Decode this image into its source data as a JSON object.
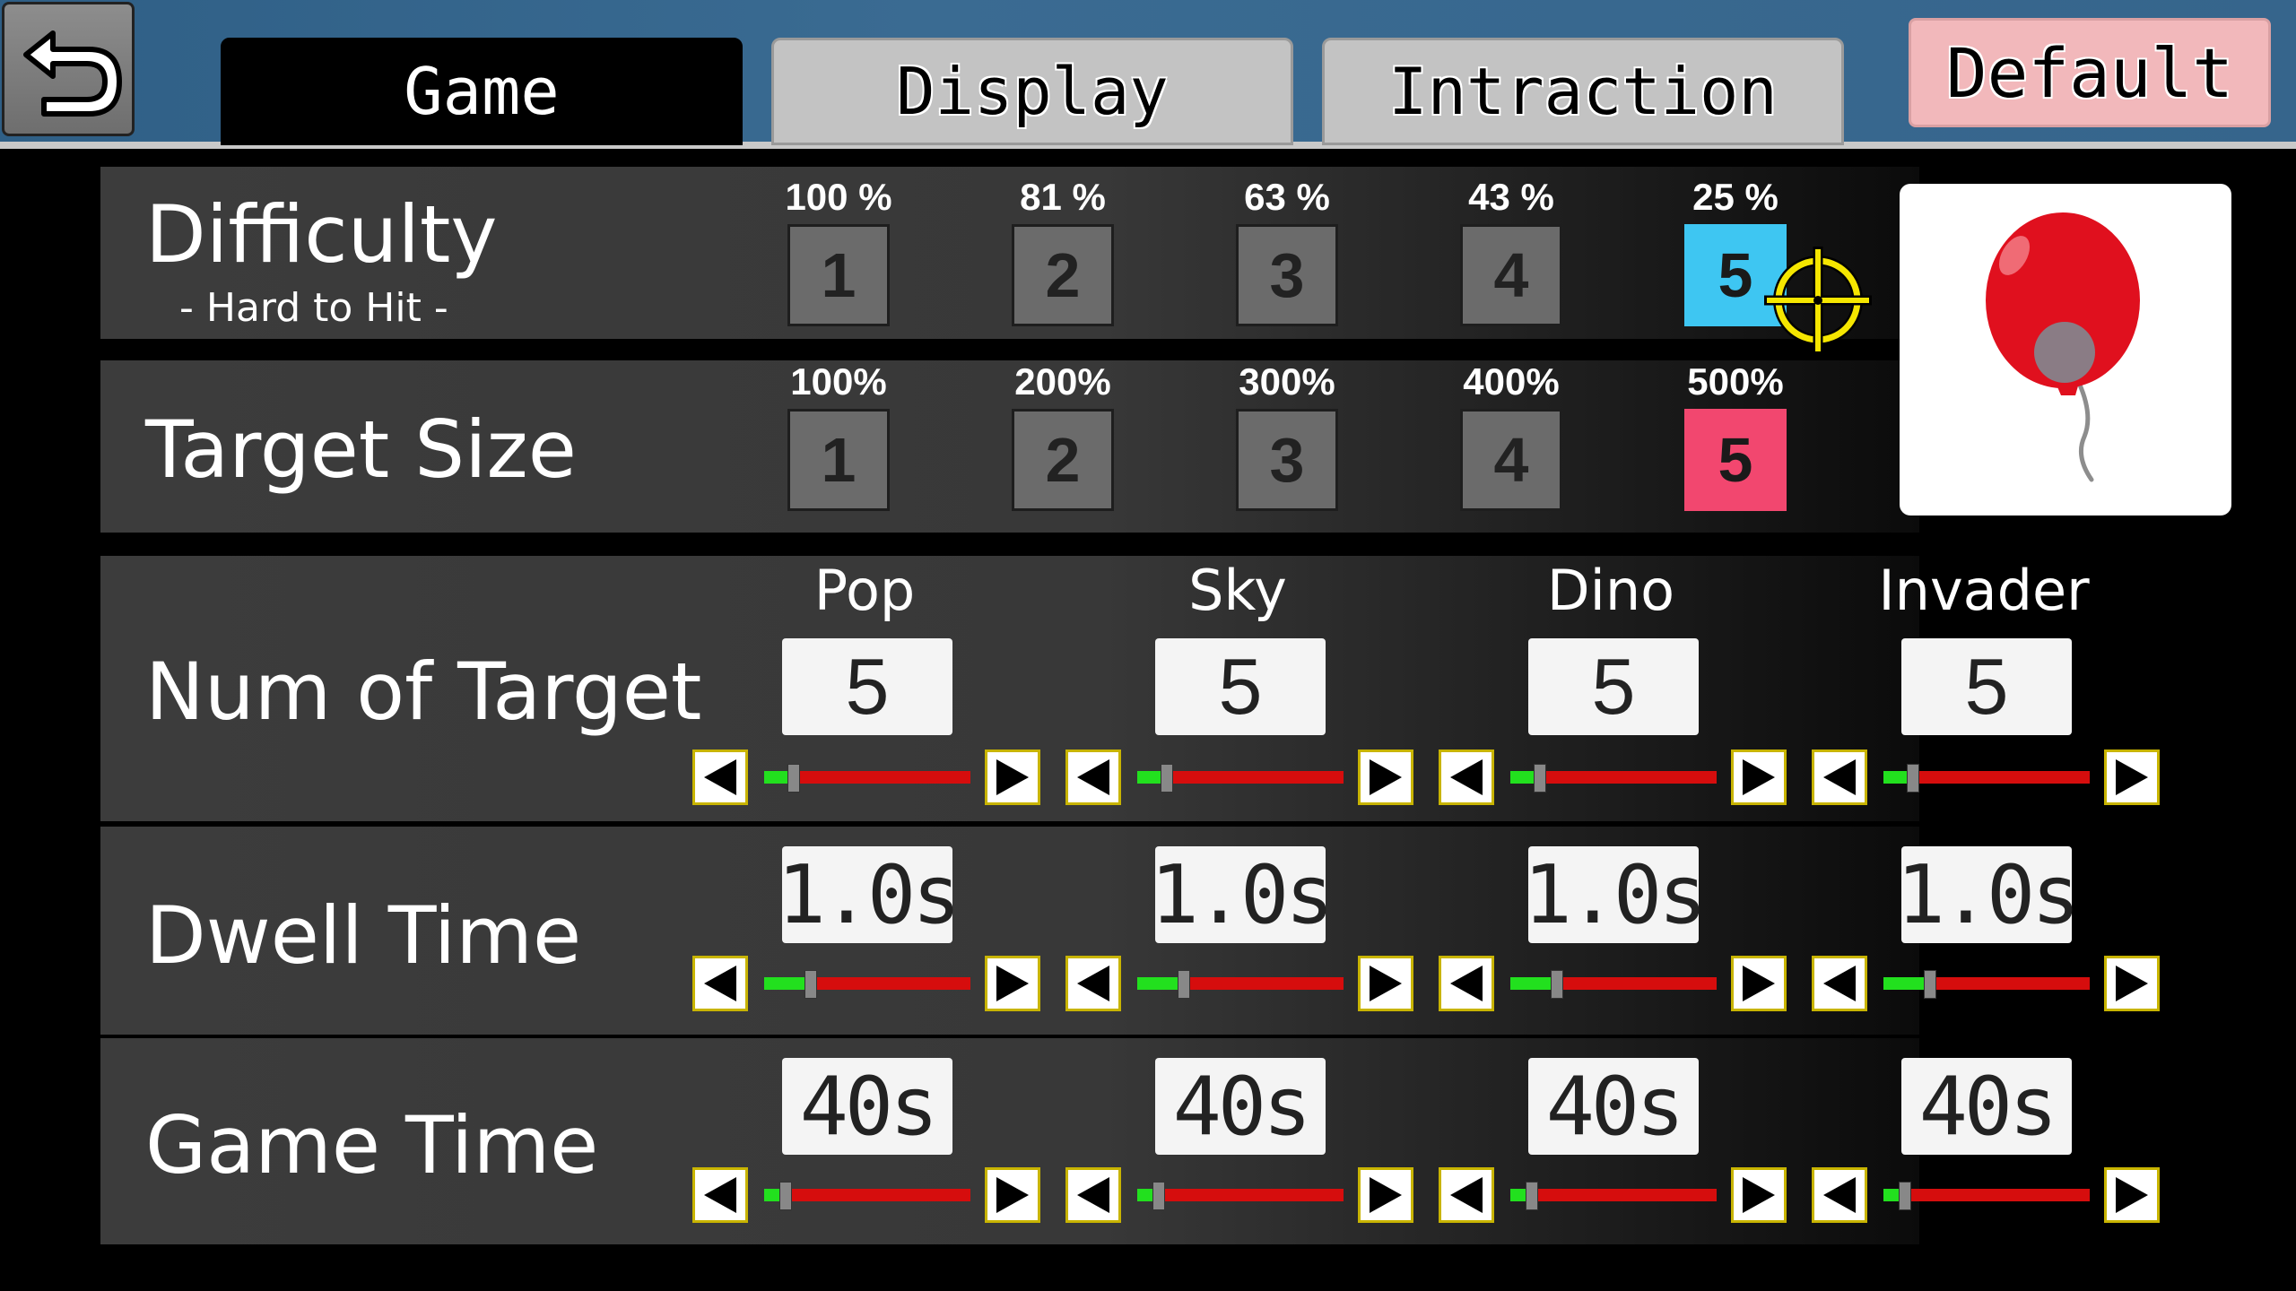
{
  "tabs": {
    "game": "Game",
    "display": "Display",
    "interaction": "Intraction",
    "default_button": "Default"
  },
  "difficulty": {
    "title": "Difficulty",
    "subtitle": "- Hard to Hit -",
    "options": [
      {
        "pct": "100 %",
        "label": "1"
      },
      {
        "pct": "81 %",
        "label": "2"
      },
      {
        "pct": "63 %",
        "label": "3"
      },
      {
        "pct": "43 %",
        "label": "4"
      },
      {
        "pct": "25 %",
        "label": "5"
      }
    ],
    "selected_index": 4,
    "selected_color": "#3ec6f2"
  },
  "target_size": {
    "title": "Target Size",
    "options": [
      {
        "pct": "100%",
        "label": "1"
      },
      {
        "pct": "200%",
        "label": "2"
      },
      {
        "pct": "300%",
        "label": "3"
      },
      {
        "pct": "400%",
        "label": "4"
      },
      {
        "pct": "500%",
        "label": "5"
      }
    ],
    "selected_index": 4,
    "selected_color": "#f2476f"
  },
  "games": [
    "Pop",
    "Sky",
    "Dino",
    "Invader"
  ],
  "num_of_target": {
    "title": "Num of Target",
    "values": [
      "5",
      "5",
      "5",
      "5"
    ],
    "levels": [
      0.14,
      0.14,
      0.14,
      0.14
    ]
  },
  "dwell_time": {
    "title": "Dwell Time",
    "values": [
      "1.0s",
      "1.0s",
      "1.0s",
      "1.0s"
    ],
    "levels": [
      0.22,
      0.22,
      0.22,
      0.22
    ]
  },
  "game_time": {
    "title": "Game Time",
    "values": [
      "40s",
      "40s",
      "40s",
      "40s"
    ],
    "levels": [
      0.1,
      0.1,
      0.1,
      0.1
    ]
  },
  "preview": {
    "icon": "red-balloon-icon"
  },
  "colors": {
    "slider_fill": "#22e01e",
    "slider_track": "#d60d0d",
    "crosshair": "#f5e600"
  }
}
